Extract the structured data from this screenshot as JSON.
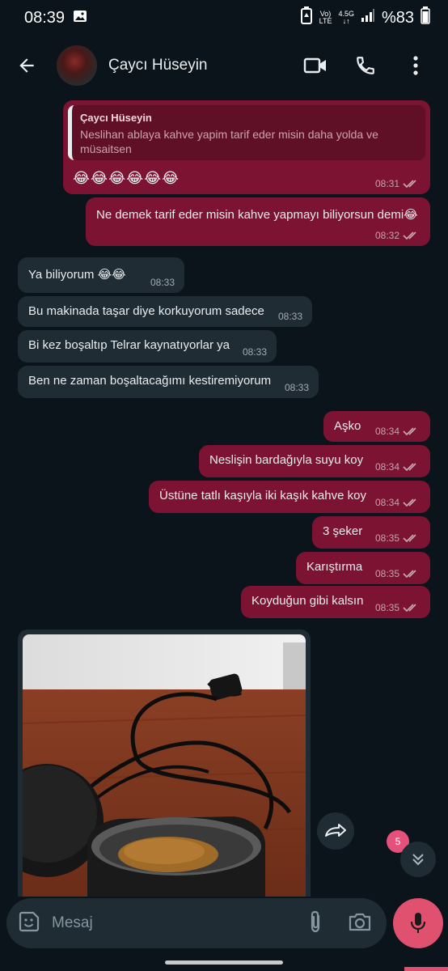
{
  "status": {
    "time": "08:39",
    "network_top": "Vo)",
    "network_bottom": "LTE",
    "gen": "4.5G",
    "battery": "%83"
  },
  "header": {
    "contact_name": "Çaycı Hüseyin"
  },
  "messages": [
    {
      "dir": "out",
      "quote_author": "Çaycı Hüseyin",
      "quote_text": "Neslihan ablaya kahve yapim tarif eder misin daha yolda ve müsaitsen",
      "text": "😂😂😂😂😂😂",
      "time": "08:31"
    },
    {
      "dir": "out",
      "text": "Ne demek tarif eder misin kahve yapmayı biliyorsun demi😂",
      "time": "08:32"
    },
    {
      "dir": "in",
      "text": "Ya biliyorum 😂😂",
      "time": "08:33"
    },
    {
      "dir": "in",
      "text": "Bu makinada taşar diye korkuyorum sadece",
      "time": "08:33"
    },
    {
      "dir": "in",
      "text": "Bi kez boşaltıp Telrar kaynatıyorlar ya",
      "time": "08:33"
    },
    {
      "dir": "in",
      "text": "Ben ne zaman boşaltacağımı kestiremiyorum",
      "time": "08:33"
    },
    {
      "dir": "out",
      "text": "Aşko",
      "time": "08:34"
    },
    {
      "dir": "out",
      "text": "Neslişin bardağıyla suyu koy",
      "time": "08:34"
    },
    {
      "dir": "out",
      "text": "Üstüne tatlı kaşıyla iki kaşık kahve koy",
      "time": "08:34"
    },
    {
      "dir": "out",
      "text": "3 şeker",
      "time": "08:35"
    },
    {
      "dir": "out",
      "text": "Karıştırma",
      "time": "08:35"
    },
    {
      "dir": "out",
      "text": "Koyduğun gibi kalsın",
      "time": "08:35"
    }
  ],
  "scroll_badge": "5",
  "composer": {
    "placeholder": "Mesaj"
  },
  "colors": {
    "outgoing": "#7c1332",
    "incoming": "#1f2c34",
    "background": "#0b141a",
    "accent": "#e0516f"
  }
}
